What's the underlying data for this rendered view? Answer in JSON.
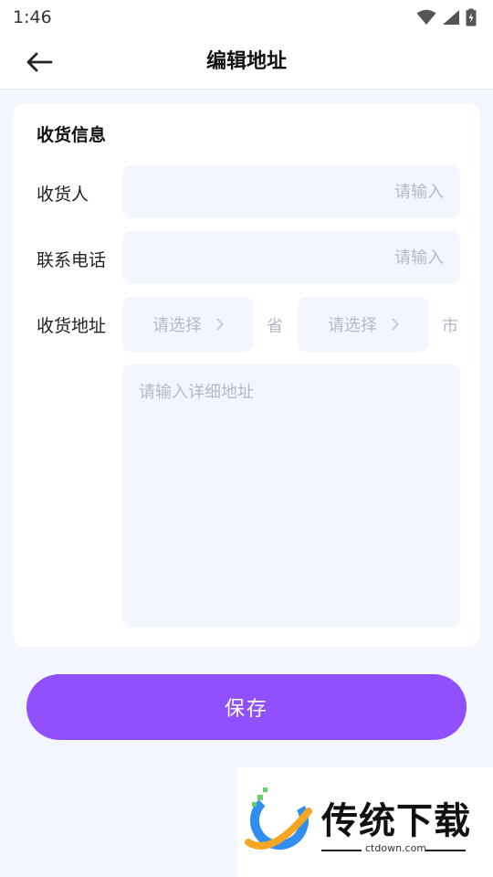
{
  "status_bar": {
    "time": "1:46"
  },
  "header": {
    "title": "编辑地址",
    "back_icon": "arrow-left-icon"
  },
  "form": {
    "section_title": "收货信息",
    "recipient": {
      "label": "收货人",
      "placeholder": "请输入"
    },
    "phone": {
      "label": "联系电话",
      "placeholder": "请输入"
    },
    "address": {
      "label": "收货地址",
      "province": {
        "placeholder": "请选择",
        "unit": "省"
      },
      "city": {
        "placeholder": "请选择",
        "unit": "市"
      },
      "detail_placeholder": "请输入详细地址"
    }
  },
  "save_button": {
    "label": "保存",
    "color": "#9050ff"
  },
  "watermark": {
    "brand": "传统下载",
    "url": "ctdown.com"
  }
}
